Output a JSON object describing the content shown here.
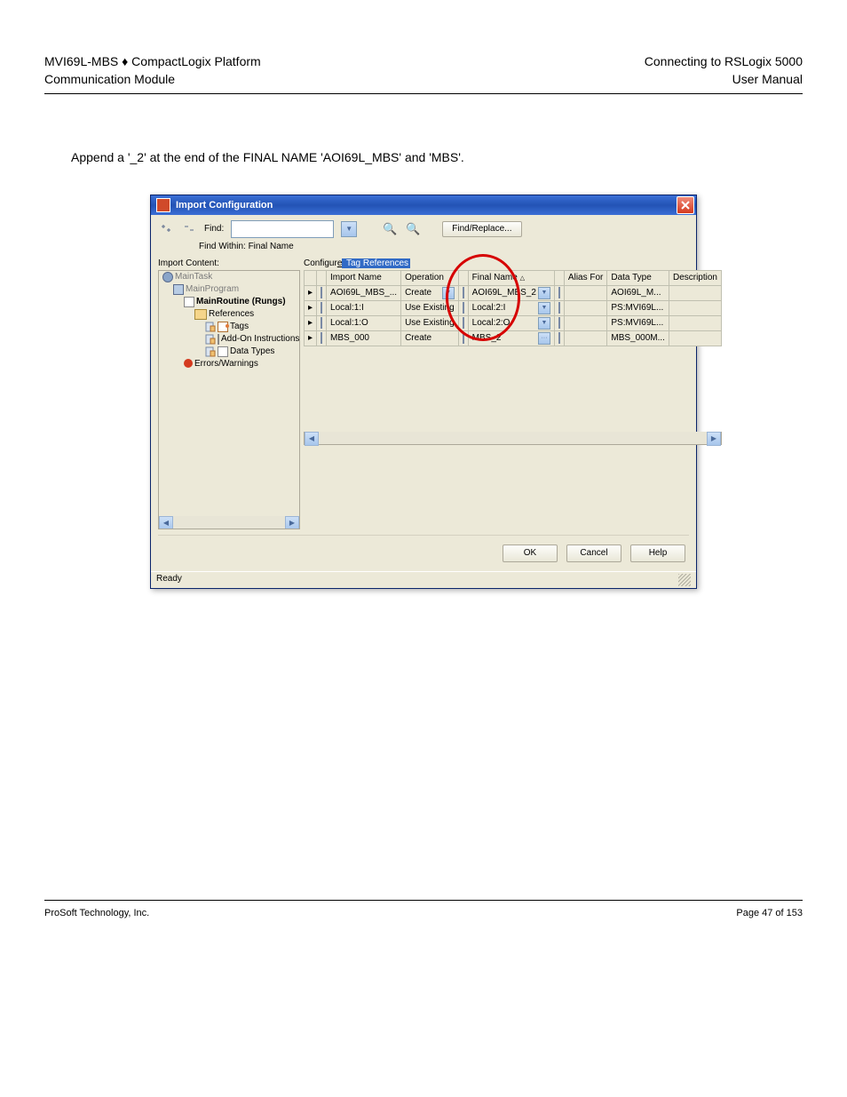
{
  "header": {
    "left_line1": "MVI69L-MBS ♦ CompactLogix Platform",
    "left_line2": "Communication Module",
    "right_line1": "Connecting to RSLogix 5000",
    "right_line2": "User Manual"
  },
  "body_text": "Append a '_2' at the end of the FINAL NAME 'AOI69L_MBS' and 'MBS'.",
  "dialog": {
    "title": "Import Configuration",
    "find_label": "Find:",
    "find_within": "Find Within: Final Name",
    "find_replace_btn": "Find/Replace...",
    "import_content_label": "Import Content:",
    "tree": {
      "maintask": "MainTask",
      "mainprogram": "MainProgram",
      "mainroutine": "MainRoutine (Rungs)",
      "references": "References",
      "tags": "Tags",
      "addon": "Add-On Instructions",
      "datatypes": "Data Types",
      "errors": "Errors/Warnings"
    },
    "config_label_plain": "Configur",
    "config_label_u": "e",
    "config_label_hl": " Tag References",
    "grid": {
      "headers": {
        "import_name": "Import Name",
        "operation": "Operation",
        "final_name": "Final Name",
        "alias_for": "Alias For",
        "data_type": "Data Type",
        "description": "Description"
      },
      "rows": [
        {
          "import_name": "AOI69L_MBS_...",
          "operation": "Create",
          "final_name": "AOI69L_MBS_2",
          "data_type": "AOI69L_M..."
        },
        {
          "import_name": "Local:1:I",
          "operation": "Use Existing",
          "final_name": "Local:2:I",
          "data_type": "PS:MVI69L..."
        },
        {
          "import_name": "Local:1:O",
          "operation": "Use Existing",
          "final_name": "Local:2:O",
          "data_type": "PS:MVI69L..."
        },
        {
          "import_name": "MBS_000",
          "operation": "Create",
          "final_name": "MBS_2",
          "data_type": "MBS_000M..."
        }
      ]
    },
    "buttons": {
      "ok": "OK",
      "cancel": "Cancel",
      "help": "Help"
    },
    "status": "Ready"
  },
  "footer": {
    "left": "ProSoft Technology, Inc.",
    "right": "Page 47 of 153"
  }
}
